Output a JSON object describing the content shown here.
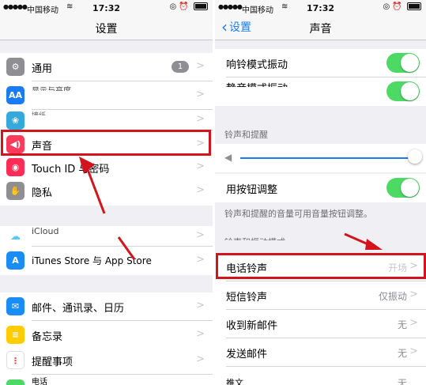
{
  "status_bar": {
    "carrier": "中国移动",
    "time": "17:32"
  },
  "left_screen": {
    "title": "设置",
    "items": [
      {
        "label": "通用",
        "badge": "1"
      },
      {
        "label": "显示与亮度",
        "icon": "AA"
      },
      {
        "label": "墙纸"
      },
      {
        "label": "声音"
      },
      {
        "label": "Touch ID 与密码"
      },
      {
        "label": "隐私"
      },
      {
        "label": "iCloud"
      },
      {
        "label": "iTunes Store 与 App Store"
      },
      {
        "label": "邮件、通讯录、日历"
      },
      {
        "label": "备忘录"
      },
      {
        "label": "提醒事项"
      },
      {
        "label": "电话"
      }
    ]
  },
  "right_screen": {
    "back_label": "设置",
    "title": "声音",
    "vibrate_on_ring": "响铃模式振动",
    "vibrate_on_silent": "静音模式振动",
    "ringer_header": "铃声和提醒",
    "change_with_buttons": "用按钮调整",
    "ringer_note": "铃声和提醒的音量可用音量按钮调整。",
    "patterns_header": "铃声和振动模式",
    "items": [
      {
        "label": "电话铃声",
        "value": "开场"
      },
      {
        "label": "短信铃声",
        "value": "仅振动"
      },
      {
        "label": "收到新邮件",
        "value": "无"
      },
      {
        "label": "发送邮件",
        "value": "无"
      },
      {
        "label": "推文",
        "value": "无"
      }
    ]
  },
  "colors": {
    "highlight": "#d4141d",
    "toggle_on": "#4cd964",
    "link": "#1a7cf5"
  }
}
